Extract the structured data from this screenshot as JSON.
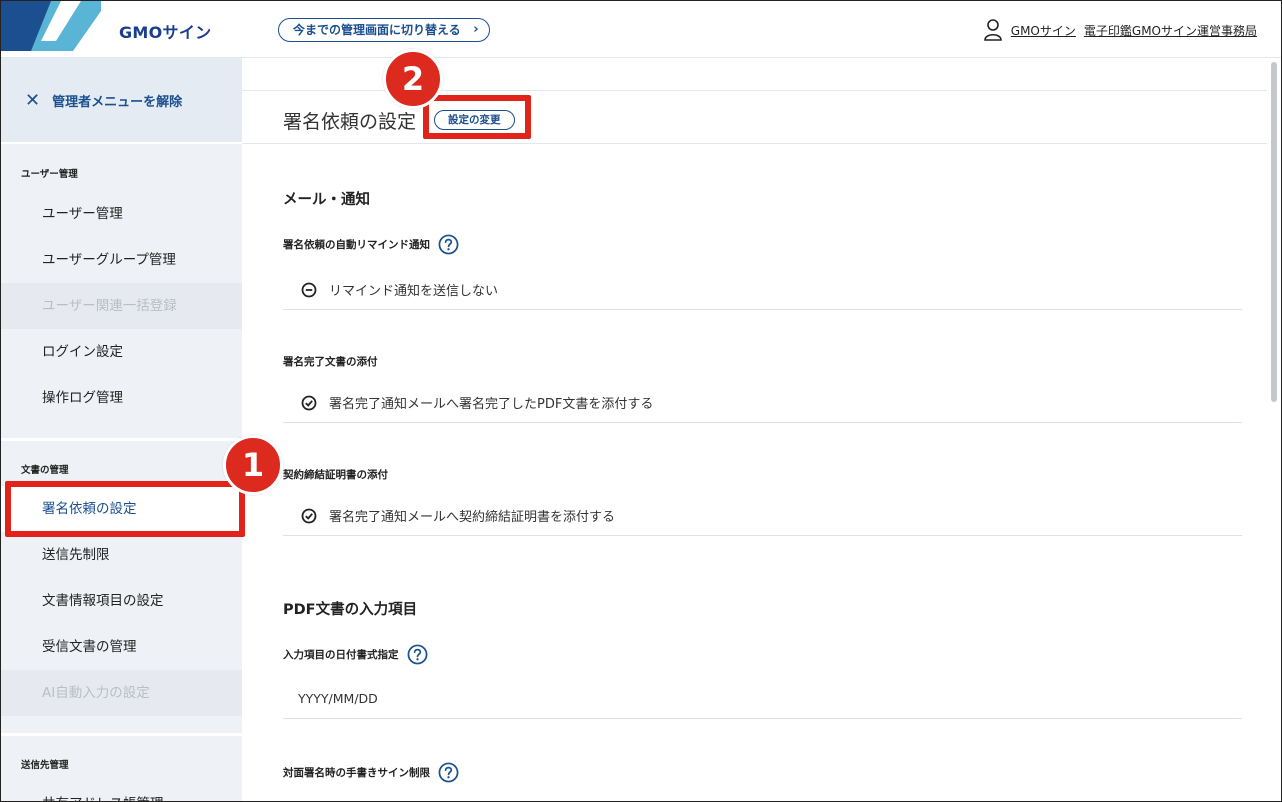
{
  "header": {
    "brand": "GMOサイン",
    "switch_button": "今までの管理画面に切り替える",
    "user_name": "GMOサイン",
    "org_name": "電子印鑑GMOサイン運営事務局"
  },
  "sidebar": {
    "close_label": "管理者メニューを解除",
    "groups": [
      {
        "label": "ユーザー管理",
        "items": [
          "ユーザー管理",
          "ユーザーグループ管理",
          "ユーザー関連一括登録",
          "ログイン設定",
          "操作ログ管理"
        ]
      },
      {
        "label": "文書の管理",
        "items": [
          "署名依頼の設定",
          "送信先制限",
          "文書情報項目の設定",
          "受信文書の管理",
          "AI自動入力の設定"
        ]
      },
      {
        "label": "送信先管理",
        "items": [
          "共有アドレス帳管理"
        ]
      }
    ]
  },
  "main": {
    "page_title": "署名依頼の設定",
    "change_button": "設定の変更",
    "sections": [
      {
        "title": "メール・通知",
        "fields": [
          {
            "label": "署名依頼の自動リマインド通知",
            "value": "リマインド通知を送信しない"
          },
          {
            "label": "署名完了文書の添付",
            "value": "署名完了通知メールへ署名完了したPDF文書を添付する"
          },
          {
            "label": "契約締結証明書の添付",
            "value": "署名完了通知メールへ契約締結証明書を添付する"
          }
        ]
      },
      {
        "title": "PDF文書の入力項目",
        "fields": [
          {
            "label": "入力項目の日付書式指定",
            "value": "YYYY/MM/DD"
          },
          {
            "label": "対面署名時の手書きサイン制限",
            "value": ""
          }
        ]
      }
    ]
  },
  "annotations": {
    "badge1": "1",
    "badge2": "2",
    "highlight_color": "#e2231a"
  },
  "colors": {
    "accent": "#1b4f8f",
    "sidebar_bg": "#eef1f5"
  }
}
